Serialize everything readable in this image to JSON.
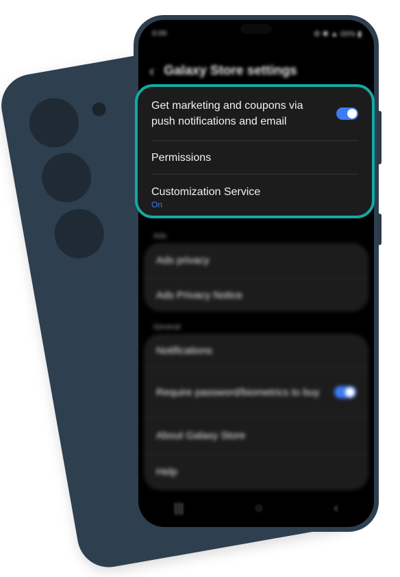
{
  "status_bar": {
    "time": "0:00",
    "icons": "⚙ ✱ ▲ 00% ▮"
  },
  "header": {
    "back_glyph": "‹",
    "title": "Galaxy Store settings"
  },
  "focused_card": {
    "marketing": {
      "label": "Get marketing and coupons via push notifications and email",
      "toggle_on": true
    },
    "permissions": {
      "label": "Permissions"
    },
    "customization": {
      "label": "Customization Service",
      "status": "On"
    }
  },
  "ads_section": {
    "label": "Ads",
    "items": [
      "Ads privacy",
      "Ads Privacy Notice"
    ]
  },
  "general_section": {
    "label": "General",
    "notifications": "Notifications",
    "require_password": {
      "label": "Require password/biometrics to buy",
      "toggle_on": true
    },
    "about": "About Galaxy Store",
    "help": "Help"
  },
  "nav_bar": {
    "recents": "|||",
    "home": "○",
    "back": "‹"
  },
  "colors": {
    "accent": "#3e7bf4",
    "highlight": "#12aaa5",
    "phone_body": "#2e3f4f"
  }
}
